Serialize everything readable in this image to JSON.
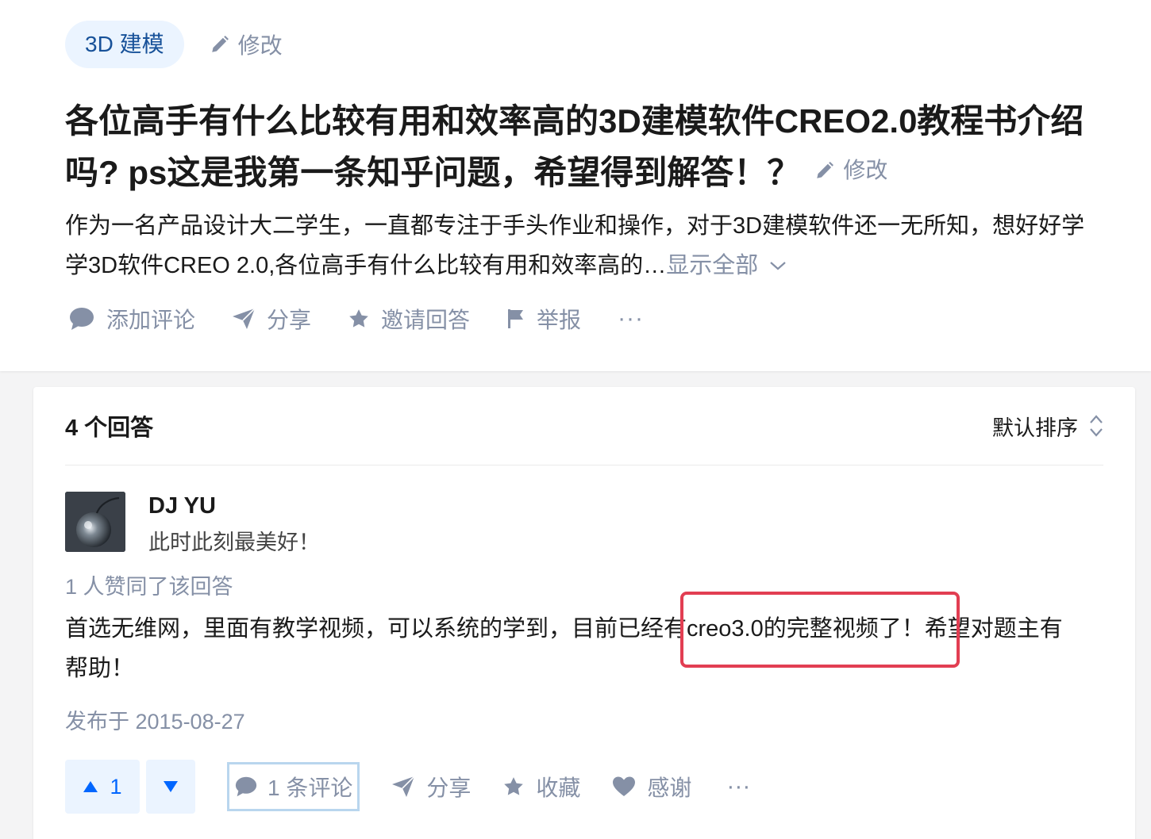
{
  "question": {
    "topic": "3D 建模",
    "topic_edit": "修改",
    "title": "各位高手有什么比较有用和效率高的3D建模软件CREO2.0教程书介绍吗? ps这是我第一条知乎问题，希望得到解答！？",
    "title_edit": "修改",
    "detail_line1": "作为一名产品设计大二学生，一直都专注于手头作业和操作，对于3D建模软件还一无所知，想好好学",
    "detail_line2": "学3D软件CREO 2.0,各位高手有什么比较有用和效率高的…",
    "show_all": "显示全部",
    "actions": {
      "comment": "添加评论",
      "share": "分享",
      "invite": "邀请回答",
      "report": "举报",
      "more": "···"
    }
  },
  "answers": {
    "count_label": "4 个回答",
    "sort_label": "默认排序"
  },
  "answer": {
    "author_name": "DJ YU",
    "author_bio": "此时此刻最美好！",
    "vote_info": "1 人赞同了该回答",
    "text_line1": "首选无维网，里面有教学视频，可以系统的学到，目前已经有creo3.0的完整视频了！希望对题主有",
    "text_line2": "帮助！",
    "publish_time": "发布于 2015-08-27",
    "upvote_count": "1",
    "actions": {
      "comments": "1 条评论",
      "share": "分享",
      "collect": "收藏",
      "thanks": "感谢",
      "more": "···"
    }
  },
  "colors": {
    "accent_blue": "#0066ff",
    "muted_gray": "#8590a6",
    "tag_bg": "#ebf4ff",
    "highlight_red": "#e23e52"
  }
}
